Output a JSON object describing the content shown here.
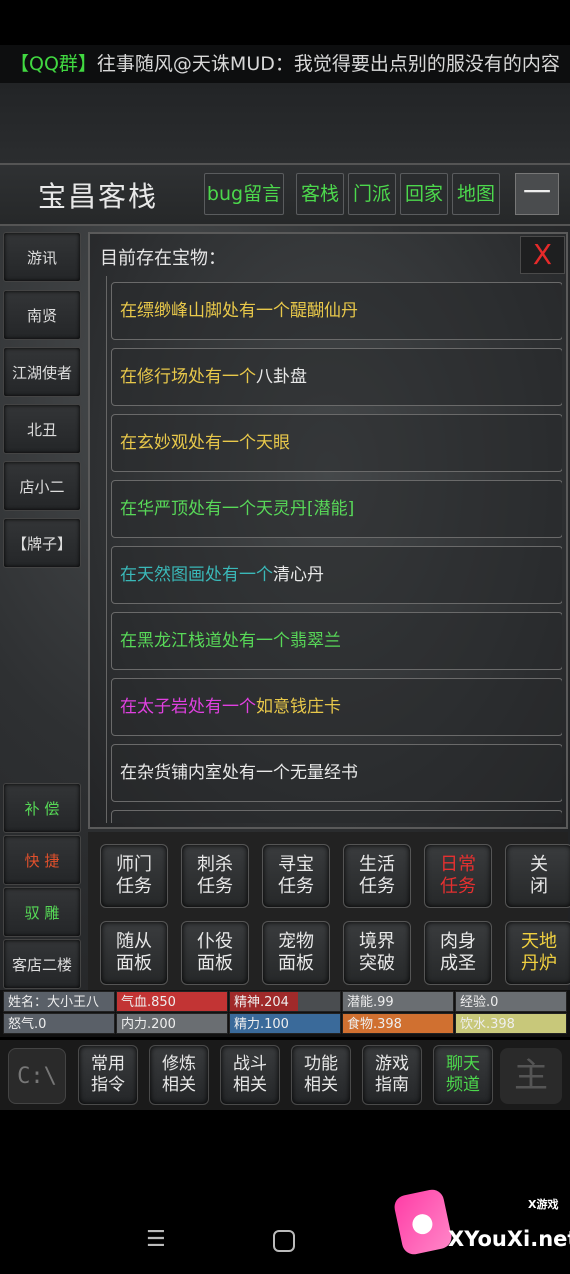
{
  "ticker": {
    "qq": "【QQ群】",
    "msg": "往事随风@天诛MUD：我觉得要出点别的服没有的内容"
  },
  "header": {
    "title": "宝昌客栈",
    "buttons": [
      "bug留言",
      "客栈",
      "门派",
      "回家",
      "地图"
    ],
    "min_label": "一"
  },
  "left_npcs": [
    "游讯",
    "南贤",
    "江湖使者",
    "北丑",
    "店小二",
    "【牌子】"
  ],
  "left_actions": [
    "补 偿",
    "快 捷",
    "驭 雕",
    "客店二楼"
  ],
  "panel": {
    "title": "目前存在宝物：",
    "close": "X",
    "items": [
      {
        "place": "在缥缈峰山脚处有一个",
        "thing": "醍醐仙丹",
        "color": "#e8c84a",
        "thing_color": "#e8c84a"
      },
      {
        "place": "在修行场处有一个",
        "thing": "八卦盘",
        "color": "#e8c84a",
        "thing_color": "#e8e8e8"
      },
      {
        "place": "在玄妙观处有一个",
        "thing": "天眼",
        "color": "#e8c84a",
        "thing_color": "#e8c84a"
      },
      {
        "place": "在华严顶处有一个",
        "thing": "天灵丹[潜能]",
        "color": "#58d858",
        "thing_color": "#58d858"
      },
      {
        "place": "在天然图画处有一个",
        "thing": "清心丹",
        "color": "#3ab8b8",
        "thing_color": "#e8e8e8"
      },
      {
        "place": "在黑龙江栈道处有一个",
        "thing": "翡翠兰",
        "color": "#58d858",
        "thing_color": "#58d858"
      },
      {
        "place": "在太子岩处有一个",
        "thing": "如意钱庄卡",
        "color": "#e040e0",
        "thing_color": "#e8c84a"
      },
      {
        "place": "在杂货铺内室处有一个",
        "thing": "无量经书",
        "color": "#e8e8e8",
        "thing_color": "#e8e8e8"
      },
      {
        "place": "",
        "thing": "",
        "color": "#e8e8e8",
        "thing_color": "#e8e8e8"
      }
    ]
  },
  "tasks": [
    {
      "label": "师门\n任务",
      "style": ""
    },
    {
      "label": "刺杀\n任务",
      "style": ""
    },
    {
      "label": "寻宝\n任务",
      "style": ""
    },
    {
      "label": "生活\n任务",
      "style": ""
    },
    {
      "label": "日常\n任务",
      "style": "red"
    },
    {
      "label": "关\n闭",
      "style": ""
    },
    {
      "label": "随从\n面板",
      "style": ""
    },
    {
      "label": "仆役\n面板",
      "style": ""
    },
    {
      "label": "宠物\n面板",
      "style": ""
    },
    {
      "label": "境界\n突破",
      "style": ""
    },
    {
      "label": "肉身\n成圣",
      "style": ""
    },
    {
      "label": "天地\n丹炉",
      "style": "gold"
    }
  ],
  "stats": [
    {
      "text": "姓名：大小王八",
      "bg": "#5a6068",
      "fill": 1.0
    },
    {
      "text": "气血.850",
      "bg": "#c23434",
      "fill": 1.0
    },
    {
      "text": "精神.204",
      "bg": "#a02a2a",
      "fill": 0.62
    },
    {
      "text": "潜能.99",
      "bg": "#6a6e72",
      "fill": 1.0
    },
    {
      "text": "经验.0",
      "bg": "#6a6e72",
      "fill": 1.0
    },
    {
      "text": "怒气.0",
      "bg": "#5a6068",
      "fill": 1.0
    },
    {
      "text": "内力.200",
      "bg": "#6a6e72",
      "fill": 1.0
    },
    {
      "text": "精力.100",
      "bg": "#3a6a9a",
      "fill": 1.0
    },
    {
      "text": "食物.398",
      "bg": "#d07030",
      "fill": 1.0
    },
    {
      "text": "饮水.398",
      "bg": "#c8c87a",
      "fill": 1.0
    }
  ],
  "bottom": [
    {
      "label": "常用\n指令",
      "style": ""
    },
    {
      "label": "修炼\n相关",
      "style": ""
    },
    {
      "label": "战斗\n相关",
      "style": ""
    },
    {
      "label": "功能\n相关",
      "style": ""
    },
    {
      "label": "游戏\n指南",
      "style": ""
    },
    {
      "label": "聊天\n频道",
      "style": "green"
    }
  ],
  "icons": {
    "console": "C:\\",
    "zhu": "主"
  },
  "watermark": {
    "small": "X游戏",
    "big": "XYouXi.net"
  }
}
